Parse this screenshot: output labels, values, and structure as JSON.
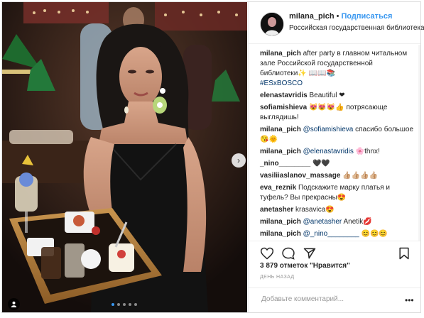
{
  "header": {
    "username": "milana_pich",
    "separator": "•",
    "follow_label": "Подписаться",
    "location": "Российская государственная библиотека"
  },
  "caption": {
    "username": "milana_pich",
    "text": "after party в главном читальном зале Российской государственной библиотеки✨",
    "emoji": "📖📖📚",
    "hashtag": "#ESxBOSCO"
  },
  "comments": [
    {
      "user": "elenastavridis",
      "mention": "",
      "text": "Beautiful ❤"
    },
    {
      "user": "sofiamishieva",
      "mention": "",
      "text": "😻😻😻👍 потрясающе выглядишь!"
    },
    {
      "user": "milana_pich",
      "mention": "@sofiamishieva",
      "text": "спасибо большое 😘🌞"
    },
    {
      "user": "milana_pich",
      "mention": "@elenastavridis",
      "text": "🌸thnx!"
    },
    {
      "user": "_nino________",
      "mention": "",
      "text": "🖤🖤"
    },
    {
      "user": "vasiliiaslanov_massage",
      "mention": "",
      "text": "👍🏼👍🏼👍🏼👍🏼"
    },
    {
      "user": "eva_reznik",
      "mention": "",
      "text": "Подскажите марку платья и туфель? Вы прекрасны😍"
    },
    {
      "user": "anetasher",
      "mention": "",
      "text": "krasavica😍"
    },
    {
      "user": "milana_pich",
      "mention": "@anetasher",
      "text": "Anetik💋"
    },
    {
      "user": "milana_pich",
      "mention": "@_nino________",
      "text": "😊😊😊"
    }
  ],
  "actions": {
    "like_icon": "heart-icon",
    "comment_icon": "comment-icon",
    "share_icon": "share-icon",
    "save_icon": "bookmark-icon"
  },
  "likes": "3 879 отметок \"Нравится\"",
  "time": "ДЕНЬ НАЗАД",
  "add_comment": {
    "placeholder": "Добавьте комментарий...",
    "more_label": "•••"
  },
  "photo": {
    "accent": "#3897f0",
    "slide_count": 5,
    "active_slide": 0,
    "next_icon": "chevron-right-icon",
    "tag_icon": "user-tag-icon"
  }
}
